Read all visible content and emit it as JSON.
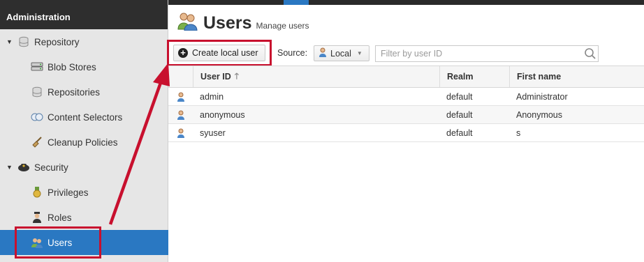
{
  "sidebar": {
    "header": "Administration",
    "items": [
      {
        "label": "Repository",
        "icon": "database-icon",
        "kind": "group"
      },
      {
        "label": "Blob Stores",
        "icon": "server-icon",
        "kind": "child"
      },
      {
        "label": "Repositories",
        "icon": "database-icon",
        "kind": "child"
      },
      {
        "label": "Content Selectors",
        "icon": "selector-icon",
        "kind": "child"
      },
      {
        "label": "Cleanup Policies",
        "icon": "broom-icon",
        "kind": "child"
      },
      {
        "label": "Security",
        "icon": "police-badge-icon",
        "kind": "group"
      },
      {
        "label": "Privileges",
        "icon": "medal-icon",
        "kind": "child"
      },
      {
        "label": "Roles",
        "icon": "role-icon",
        "kind": "child"
      },
      {
        "label": "Users",
        "icon": "users-icon",
        "kind": "child",
        "selected": true
      }
    ]
  },
  "header": {
    "title": "Users",
    "subtitle": "Manage users"
  },
  "toolbar": {
    "create_label": "Create local user",
    "source_label": "Source:",
    "source_value": "Local",
    "filter_placeholder": "Filter by user ID"
  },
  "grid": {
    "columns": [
      "User ID",
      "Realm",
      "First name"
    ],
    "sorted_column": "User ID",
    "sort_direction": "ascending",
    "rows": [
      {
        "user_id": "admin",
        "realm": "default",
        "first_name": "Administrator"
      },
      {
        "user_id": "anonymous",
        "realm": "default",
        "first_name": "Anonymous"
      },
      {
        "user_id": "syuser",
        "realm": "default",
        "first_name": "s"
      }
    ]
  },
  "colors": {
    "selected": "#2a78c2",
    "highlight": "#c8102e",
    "sidebar_bg": "#e6e6e6",
    "sidebar_header_bg": "#2e2e2e"
  }
}
